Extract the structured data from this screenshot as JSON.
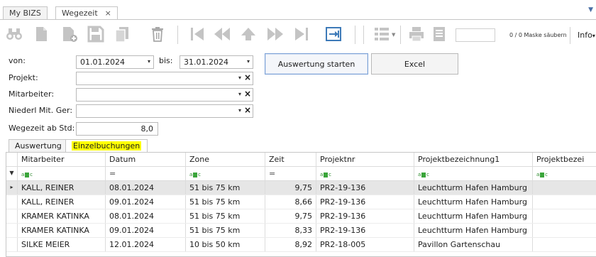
{
  "doc_tabs": [
    {
      "label": "My BIZS",
      "active": false
    },
    {
      "label": "Wegezeit",
      "active": true,
      "close": "×"
    }
  ],
  "toolbar": {
    "record_counter": "0 / 0 Maske säubern",
    "info_label": "Info",
    "info_caret": "▾",
    "icons": [
      "binoculars-icon",
      "new-document-icon",
      "add-document-icon",
      "save-icon",
      "copy-icon",
      "delete-icon",
      "first-record-icon",
      "previous-page-icon",
      "previous-record-icon",
      "next-page-icon",
      "last-record-icon",
      "go-to-icon",
      "list-view-icon",
      "print-icon",
      "report-icon"
    ]
  },
  "filters": {
    "von_label": "von:",
    "von_value": "01.01.2024",
    "bis_label": "bis:",
    "bis_value": "31.01.2024",
    "projekt_label": "Projekt:",
    "projekt_value": "",
    "mitarbeiter_label": "Mitarbeiter:",
    "mitarbeiter_value": "",
    "niederl_label": "Niederl Mit. Ger:",
    "niederl_value": "",
    "wegezeit_label": "Wegezeit ab Std:",
    "wegezeit_value": "8,0",
    "dropdown_glyph": "▾",
    "clear_glyph": "×"
  },
  "buttons": {
    "start": "Auswertung starten",
    "excel": "Excel"
  },
  "content_tabs": [
    {
      "label": "Auswertung",
      "active": false
    },
    {
      "label": "Einzelbuchungen",
      "active": true
    }
  ],
  "grid": {
    "columns": [
      "Mitarbeiter",
      "Datum",
      "Zone",
      "Zeit",
      "Projektnr",
      "Projektbezeichnung1",
      "Projektbezei"
    ],
    "filter_row": [
      "abc",
      "=",
      "abc",
      "=",
      "abc",
      "abc",
      "abc"
    ],
    "filter_text": "a",
    "filter_text2": "c",
    "equals": "=",
    "selected_marker": "▸",
    "filter_marker": "▼",
    "rows": [
      {
        "mitarbeiter": "KALL, REINER",
        "datum": "08.01.2024",
        "zone": "51 bis 75 km",
        "zeit": "9,75",
        "projektnr": "PR2-19-136",
        "bez1": "Leuchtturm Hafen Hamburg",
        "bez2": ""
      },
      {
        "mitarbeiter": "KALL, REINER",
        "datum": "09.01.2024",
        "zone": "51 bis 75 km",
        "zeit": "8,66",
        "projektnr": "PR2-19-136",
        "bez1": "Leuchtturm Hafen Hamburg",
        "bez2": ""
      },
      {
        "mitarbeiter": "KRAMER KATINKA",
        "datum": "08.01.2024",
        "zone": "51 bis 75 km",
        "zeit": "9,75",
        "projektnr": "PR2-19-136",
        "bez1": "Leuchtturm Hafen Hamburg",
        "bez2": ""
      },
      {
        "mitarbeiter": "KRAMER KATINKA",
        "datum": "09.01.2024",
        "zone": "51 bis 75 km",
        "zeit": "8,33",
        "projektnr": "PR2-19-136",
        "bez1": "Leuchtturm Hafen Hamburg",
        "bez2": ""
      },
      {
        "mitarbeiter": "SILKE MEIER",
        "datum": "12.01.2024",
        "zone": "10 bis 50 km",
        "zeit": "8,92",
        "projektnr": "PR2-18-005",
        "bez1": "Pavillon Gartenschau",
        "bez2": ""
      }
    ]
  },
  "colors": {
    "accent": "#3d7ab8",
    "icon_gray": "#c4c4c4",
    "highlight": "#ffff00",
    "selected_row": "#e6e6e6"
  }
}
